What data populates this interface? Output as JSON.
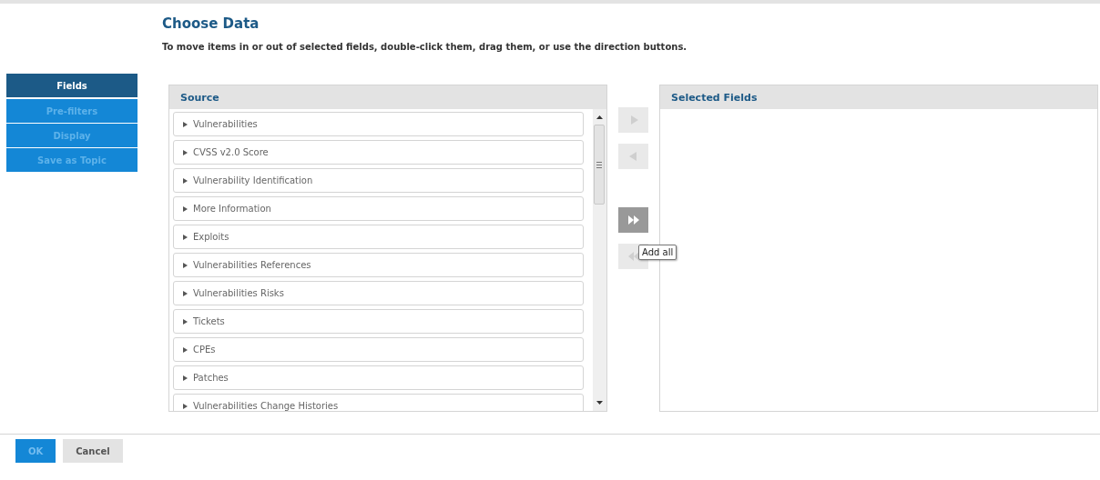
{
  "title": "Choose Data",
  "instructions": "To move items in or out of selected fields, double-click them, drag them, or use the direction buttons.",
  "sidebar": {
    "items": [
      {
        "label": "Fields",
        "selected": true,
        "disabled": false
      },
      {
        "label": "Pre-filters",
        "selected": false,
        "disabled": true
      },
      {
        "label": "Display",
        "selected": false,
        "disabled": true
      },
      {
        "label": "Save as Topic",
        "selected": false,
        "disabled": true
      }
    ]
  },
  "source": {
    "title": "Source",
    "items": [
      {
        "label": "Vulnerabilities",
        "expanded": false
      },
      {
        "label": "CVSS v2.0 Score",
        "expanded": false
      },
      {
        "label": "Vulnerability Identification",
        "expanded": false
      },
      {
        "label": "More Information",
        "expanded": false
      },
      {
        "label": "Exploits",
        "expanded": false
      },
      {
        "label": "Vulnerabilities References",
        "expanded": false
      },
      {
        "label": "Vulnerabilities Risks",
        "expanded": false
      },
      {
        "label": "Tickets",
        "expanded": false
      },
      {
        "label": "CPEs",
        "expanded": false
      },
      {
        "label": "Patches",
        "expanded": false
      },
      {
        "label": "Vulnerabilities Change Histories",
        "expanded": false
      }
    ]
  },
  "move_buttons": [
    {
      "kind": "add",
      "disabled": true
    },
    {
      "kind": "remove",
      "disabled": true
    },
    {
      "kind": "add_all",
      "disabled": false
    },
    {
      "kind": "remove_all",
      "disabled": true
    }
  ],
  "tooltip": "Add all",
  "selected_fields": {
    "title": "Selected Fields"
  },
  "footer": {
    "buttons": [
      {
        "label": "OK",
        "kind": "primary",
        "disabled": true
      },
      {
        "label": "Cancel",
        "kind": "secondary",
        "disabled": false
      }
    ]
  }
}
